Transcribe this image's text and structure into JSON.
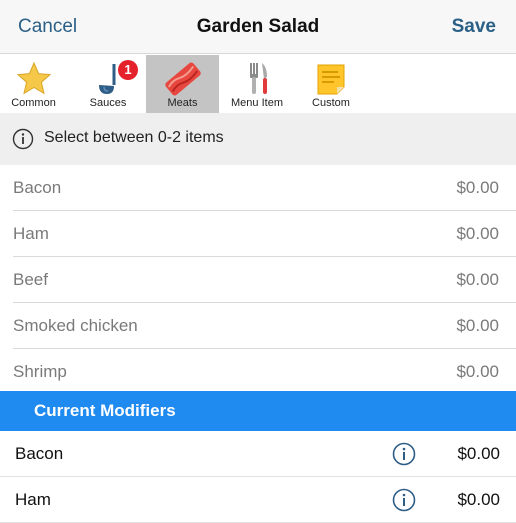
{
  "header": {
    "cancel_label": "Cancel",
    "title": "Garden Salad",
    "save_label": "Save"
  },
  "tabs": [
    {
      "label": "Common",
      "icon": "star-icon",
      "active": false
    },
    {
      "label": "Sauces",
      "icon": "sauce-ladle-icon",
      "badge": "1",
      "active": false
    },
    {
      "label": "Meats",
      "icon": "bacon-icon",
      "active": true
    },
    {
      "label": "Menu Item",
      "icon": "utensils-icon",
      "active": false
    },
    {
      "label": "Custom",
      "icon": "sticky-note-icon",
      "active": false
    }
  ],
  "hint": {
    "icon": "info-icon",
    "text": "Select between 0-2 items"
  },
  "options": [
    {
      "name": "Bacon",
      "price": "$0.00"
    },
    {
      "name": "Ham",
      "price": "$0.00"
    },
    {
      "name": "Beef",
      "price": "$0.00"
    },
    {
      "name": "Smoked chicken",
      "price": "$0.00"
    },
    {
      "name": "Shrimp",
      "price": "$0.00"
    }
  ],
  "current_modifiers": {
    "header": "Current Modifiers",
    "items": [
      {
        "name": "Bacon",
        "price": "$0.00"
      },
      {
        "name": "Ham",
        "price": "$0.00"
      }
    ]
  },
  "colors": {
    "accent": "#1f8af0",
    "link": "#2a5f86",
    "badge": "#e5212b",
    "active_tab": "#c4c4c4"
  }
}
